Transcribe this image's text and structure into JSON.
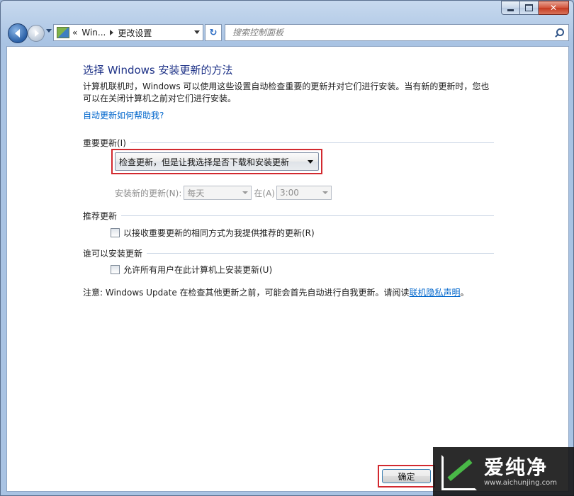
{
  "window": {
    "caption_close": "✕"
  },
  "nav": {
    "breadcrumb_prefix": "«",
    "breadcrumb_parent": "Win...",
    "breadcrumb_current": "更改设置",
    "refresh_glyph": "↻",
    "search_placeholder": "搜索控制面板"
  },
  "page": {
    "title": "选择 Windows 安装更新的方法",
    "intro": "计算机联机时，Windows 可以使用这些设置自动检查重要的更新并对它们进行安装。当有新的更新时，您也可以在关闭计算机之前对它们进行安装。",
    "help_link": "自动更新如何帮助我?"
  },
  "important_updates": {
    "heading": "重要更新(I)",
    "selected_option": "检查更新，但是让我选择是否下载和安装更新",
    "install_label": "安装新的更新(N):",
    "day_value": "每天",
    "at_label": "在(A)",
    "time_value": "3:00"
  },
  "recommended_updates": {
    "heading": "推荐更新",
    "checkbox_label": "以接收重要更新的相同方式为我提供推荐的更新(R)",
    "checked": false
  },
  "who_can_install": {
    "heading": "谁可以安装更新",
    "checkbox_label": "允许所有用户在此计算机上安装更新(U)",
    "checked": false
  },
  "note": {
    "text": "注意: Windows Update 在检查其他更新之前，可能会首先自动进行自我更新。请阅读",
    "link": "联机隐私声明",
    "suffix": "。"
  },
  "buttons": {
    "ok": "确定"
  },
  "watermark": {
    "title": "爱纯净",
    "url": "www.aichunjing.com"
  },
  "colors": {
    "highlight_border": "#d2292f",
    "title_blue": "#1e3287",
    "link_blue": "#0066cc"
  }
}
